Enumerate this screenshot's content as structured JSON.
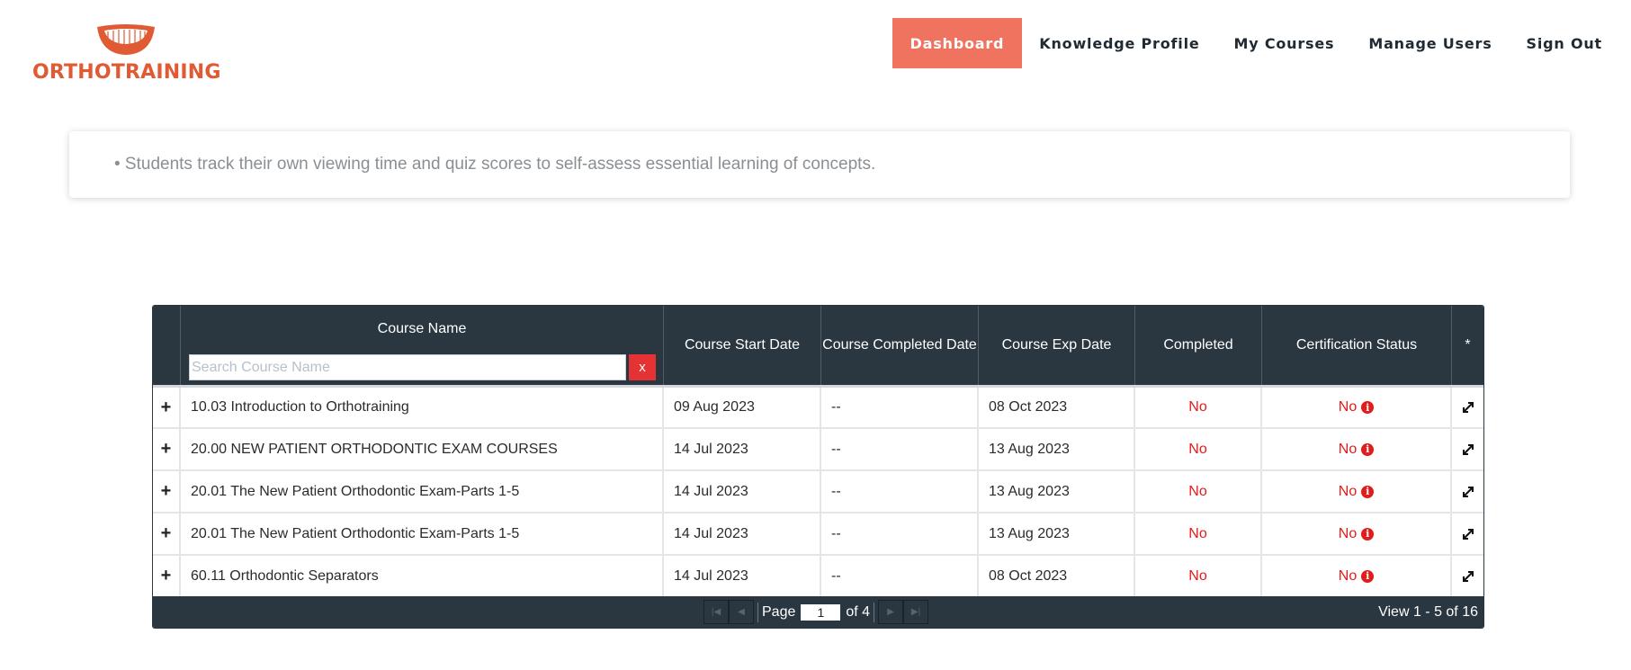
{
  "brand": {
    "name": "ORTHOTRAINING",
    "logo_icon": "smile-icon",
    "color": "#e05a33"
  },
  "nav": {
    "items": [
      {
        "label": "Dashboard",
        "active": true
      },
      {
        "label": "Knowledge Profile",
        "active": false
      },
      {
        "label": "My Courses",
        "active": false
      },
      {
        "label": "Manage Users",
        "active": false
      },
      {
        "label": "Sign Out",
        "active": false
      }
    ]
  },
  "info": {
    "text": "• Students track their own viewing time and quiz scores to self-assess essential learning of concepts."
  },
  "table": {
    "headers": {
      "course_name": "Course Name",
      "start_date": "Course Start Date",
      "completed_date": "Course Completed Date",
      "exp_date": "Course Exp Date",
      "completed": "Completed",
      "cert_status": "Certification Status",
      "star": "*"
    },
    "search": {
      "placeholder": "Search Course Name",
      "value": "",
      "clear_label": "x"
    },
    "rows": [
      {
        "expand": "+",
        "name": "10.03 Introduction to Orthotraining",
        "start": "09 Aug 2023",
        "completed_date": "--",
        "exp": "08 Oct 2023",
        "completed": "No",
        "cert": "No"
      },
      {
        "expand": "+",
        "name": "20.00 NEW PATIENT ORTHODONTIC EXAM COURSES",
        "start": "14 Jul 2023",
        "completed_date": "--",
        "exp": "13 Aug 2023",
        "completed": "No",
        "cert": "No"
      },
      {
        "expand": "+",
        "name": "20.01 The New Patient Orthodontic Exam-Parts 1-5",
        "start": "14 Jul 2023",
        "completed_date": "--",
        "exp": "13 Aug 2023",
        "completed": "No",
        "cert": "No"
      },
      {
        "expand": "+",
        "name": "20.01 The New Patient Orthodontic Exam-Parts 1-5",
        "start": "14 Jul 2023",
        "completed_date": "--",
        "exp": "13 Aug 2023",
        "completed": "No",
        "cert": "No"
      },
      {
        "expand": "+",
        "name": "60.11 Orthodontic Separators",
        "start": "14 Jul 2023",
        "completed_date": "--",
        "exp": "08 Oct 2023",
        "completed": "No",
        "cert": "No"
      }
    ]
  },
  "pager": {
    "page_label": "Page",
    "page": "1",
    "of_label": "of 4",
    "view": "View 1 - 5 of 16"
  },
  "colors": {
    "accent": "#f07360",
    "header_bg": "#2a3640",
    "status_no": "#e21b1b"
  }
}
